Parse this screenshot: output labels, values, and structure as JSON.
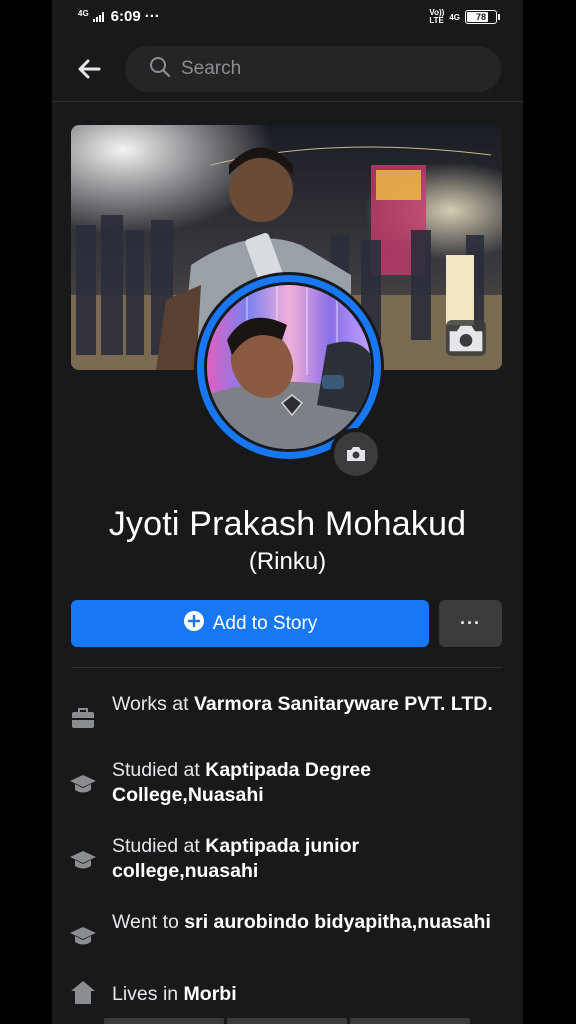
{
  "status_bar": {
    "network_left": "4G",
    "time": "6:09",
    "dots": "···",
    "network_right_top": "Vo))",
    "network_right_bottom": "LTE",
    "network_type": "4G",
    "battery": "78",
    "battery_level_percent": 78
  },
  "header": {
    "back_icon": "arrow-left-icon",
    "search_placeholder": "Search"
  },
  "profile": {
    "cover_camera_icon": "camera-icon",
    "avatar_camera_icon": "camera-icon",
    "name": "Jyoti Prakash Mohakud",
    "nickname": "(Rinku)"
  },
  "actions": {
    "add_story_label": "Add to Story",
    "more_label": "···"
  },
  "details": [
    {
      "icon": "briefcase-icon",
      "prefix": "Works at ",
      "value": "Varmora Sanitaryware PVT. LTD."
    },
    {
      "icon": "graduation-cap-icon",
      "prefix": "Studied at ",
      "value": "Kaptipada Degree College,Nuasahi"
    },
    {
      "icon": "graduation-cap-icon",
      "prefix": "Studied at ",
      "value": "Kaptipada junior college,nuasahi"
    },
    {
      "icon": "graduation-cap-icon",
      "prefix": "Went to ",
      "value": "sri aurobindo bidyapitha,nuasahi"
    },
    {
      "icon": "home-icon",
      "prefix": "Lives in ",
      "value": "Morbi"
    }
  ],
  "colors": {
    "background": "#18191a",
    "accent": "#1877f2",
    "button_secondary": "#3a3b3c",
    "search_bg": "#242526",
    "text_secondary": "#8a8d91"
  }
}
